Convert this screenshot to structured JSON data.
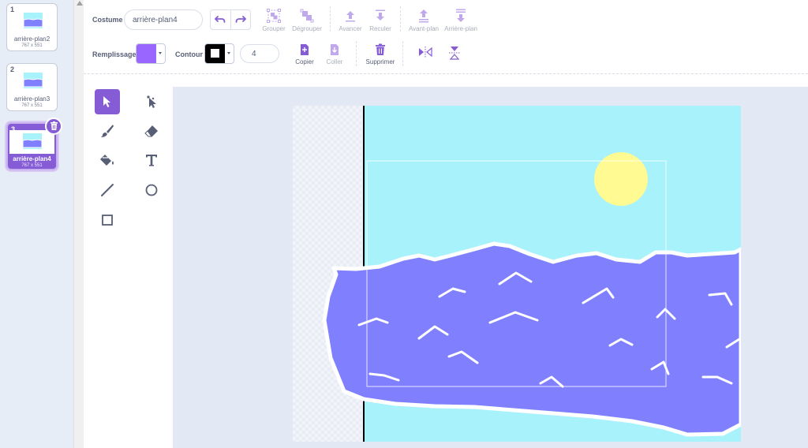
{
  "costumes": [
    {
      "number": "1",
      "name": "arrière-plan2",
      "size": "767 x 551"
    },
    {
      "number": "2",
      "name": "arrière-plan3",
      "size": "767 x 551"
    },
    {
      "number": "3",
      "name": "arrière-plan4",
      "size": "767 x 551"
    }
  ],
  "toolbar": {
    "costume_label": "Costume",
    "costume_name": "arrière-plan4",
    "group": "Grouper",
    "ungroup": "Dégrouper",
    "forward": "Avancer",
    "backward": "Reculer",
    "front": "Avant-plan",
    "back": "Arrière-plan",
    "fill_label": "Remplissage",
    "outline_label": "Contour",
    "outline_width": "4",
    "copy": "Copier",
    "paste": "Coller",
    "delete": "Supprimer"
  },
  "colors": {
    "accent": "#855cd6",
    "fill": "#9966ff",
    "outline": "#000000",
    "sky": "#a8f2fb",
    "sea": "#8080ff",
    "sun": "#fffa91"
  },
  "tools": [
    "select-icon",
    "reshape-icon",
    "brush-icon",
    "eraser-icon",
    "fill-icon",
    "text-icon",
    "line-icon",
    "circle-icon",
    "rectangle-icon"
  ]
}
